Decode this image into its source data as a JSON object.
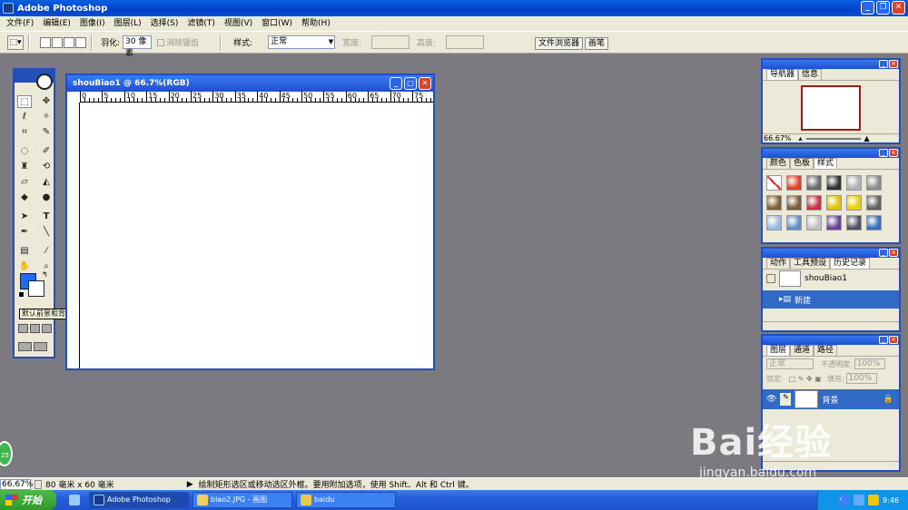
{
  "app": {
    "title": "Adobe Photoshop"
  },
  "menu": [
    "文件(F)",
    "编辑(E)",
    "图像(I)",
    "图层(L)",
    "选择(S)",
    "滤镜(T)",
    "视图(V)",
    "窗口(W)",
    "帮助(H)"
  ],
  "options": {
    "feather_label": "羽化:",
    "feather_value": "30 像素",
    "antialias_label": "消除锯齿",
    "style_label": "样式:",
    "style_value": "正常",
    "width_label": "宽度:",
    "height_label": "高度:",
    "well_tabs": [
      "文件浏览器",
      "画笔"
    ]
  },
  "toolbox": {
    "tooltip": "默认前景和背景色 (D)",
    "fg_color": "#1c6cf6",
    "bg_color": "#ffffff"
  },
  "document": {
    "title": "shouBiao1 @ 66.7%(RGB)",
    "ruler_ticks": [
      "0",
      "5",
      "10",
      "15",
      "20",
      "25",
      "30",
      "35",
      "40",
      "45",
      "50",
      "55",
      "60",
      "65",
      "70",
      "75"
    ]
  },
  "panels": {
    "navigator": {
      "tabs": [
        "导航器",
        "信息"
      ],
      "zoom": "66.67%"
    },
    "swatches": {
      "tabs": [
        "颜色",
        "色板",
        "样式"
      ],
      "styles": [
        "#ffffff",
        "#e04020",
        "#6a6a6a",
        "#303030",
        "#b0b0b0",
        "#8a8a8a",
        "#806030",
        "#7a5a38",
        "#c83040",
        "#e0c000",
        "#e8d000",
        "#606060",
        "#9ab8e0",
        "#6090c8",
        "#c0c0c0",
        "#6a40a0",
        "#505060",
        "#3070c0"
      ]
    },
    "history": {
      "tabs": [
        "动作",
        "工具预设",
        "历史记录"
      ],
      "snapshot": "shouBiao1",
      "step": "新建"
    },
    "layers": {
      "tabs": [
        "图层",
        "通道",
        "路径"
      ],
      "mode": "正常",
      "opacity_label": "不透明度:",
      "opacity": "100%",
      "lock_label": "锁定:",
      "fill_label": "填充:",
      "fill": "100%",
      "layer_name": "背景"
    }
  },
  "status": {
    "zoom": "66.67%",
    "doc_size": "80 毫米 x 60 毫米",
    "hint": "绘制矩形选区或移动选区外框。要用附加选项，使用 Shift、Alt 和 Ctrl 键。"
  },
  "taskbar": {
    "start": "开始",
    "tasks": [
      "Adobe Photoshop",
      "biao2.JPG - 画图",
      "baidu"
    ],
    "time": "9:46"
  },
  "watermark": {
    "brand": "Bai经验",
    "url": "jingyan.baidu.com"
  },
  "badge": "25"
}
